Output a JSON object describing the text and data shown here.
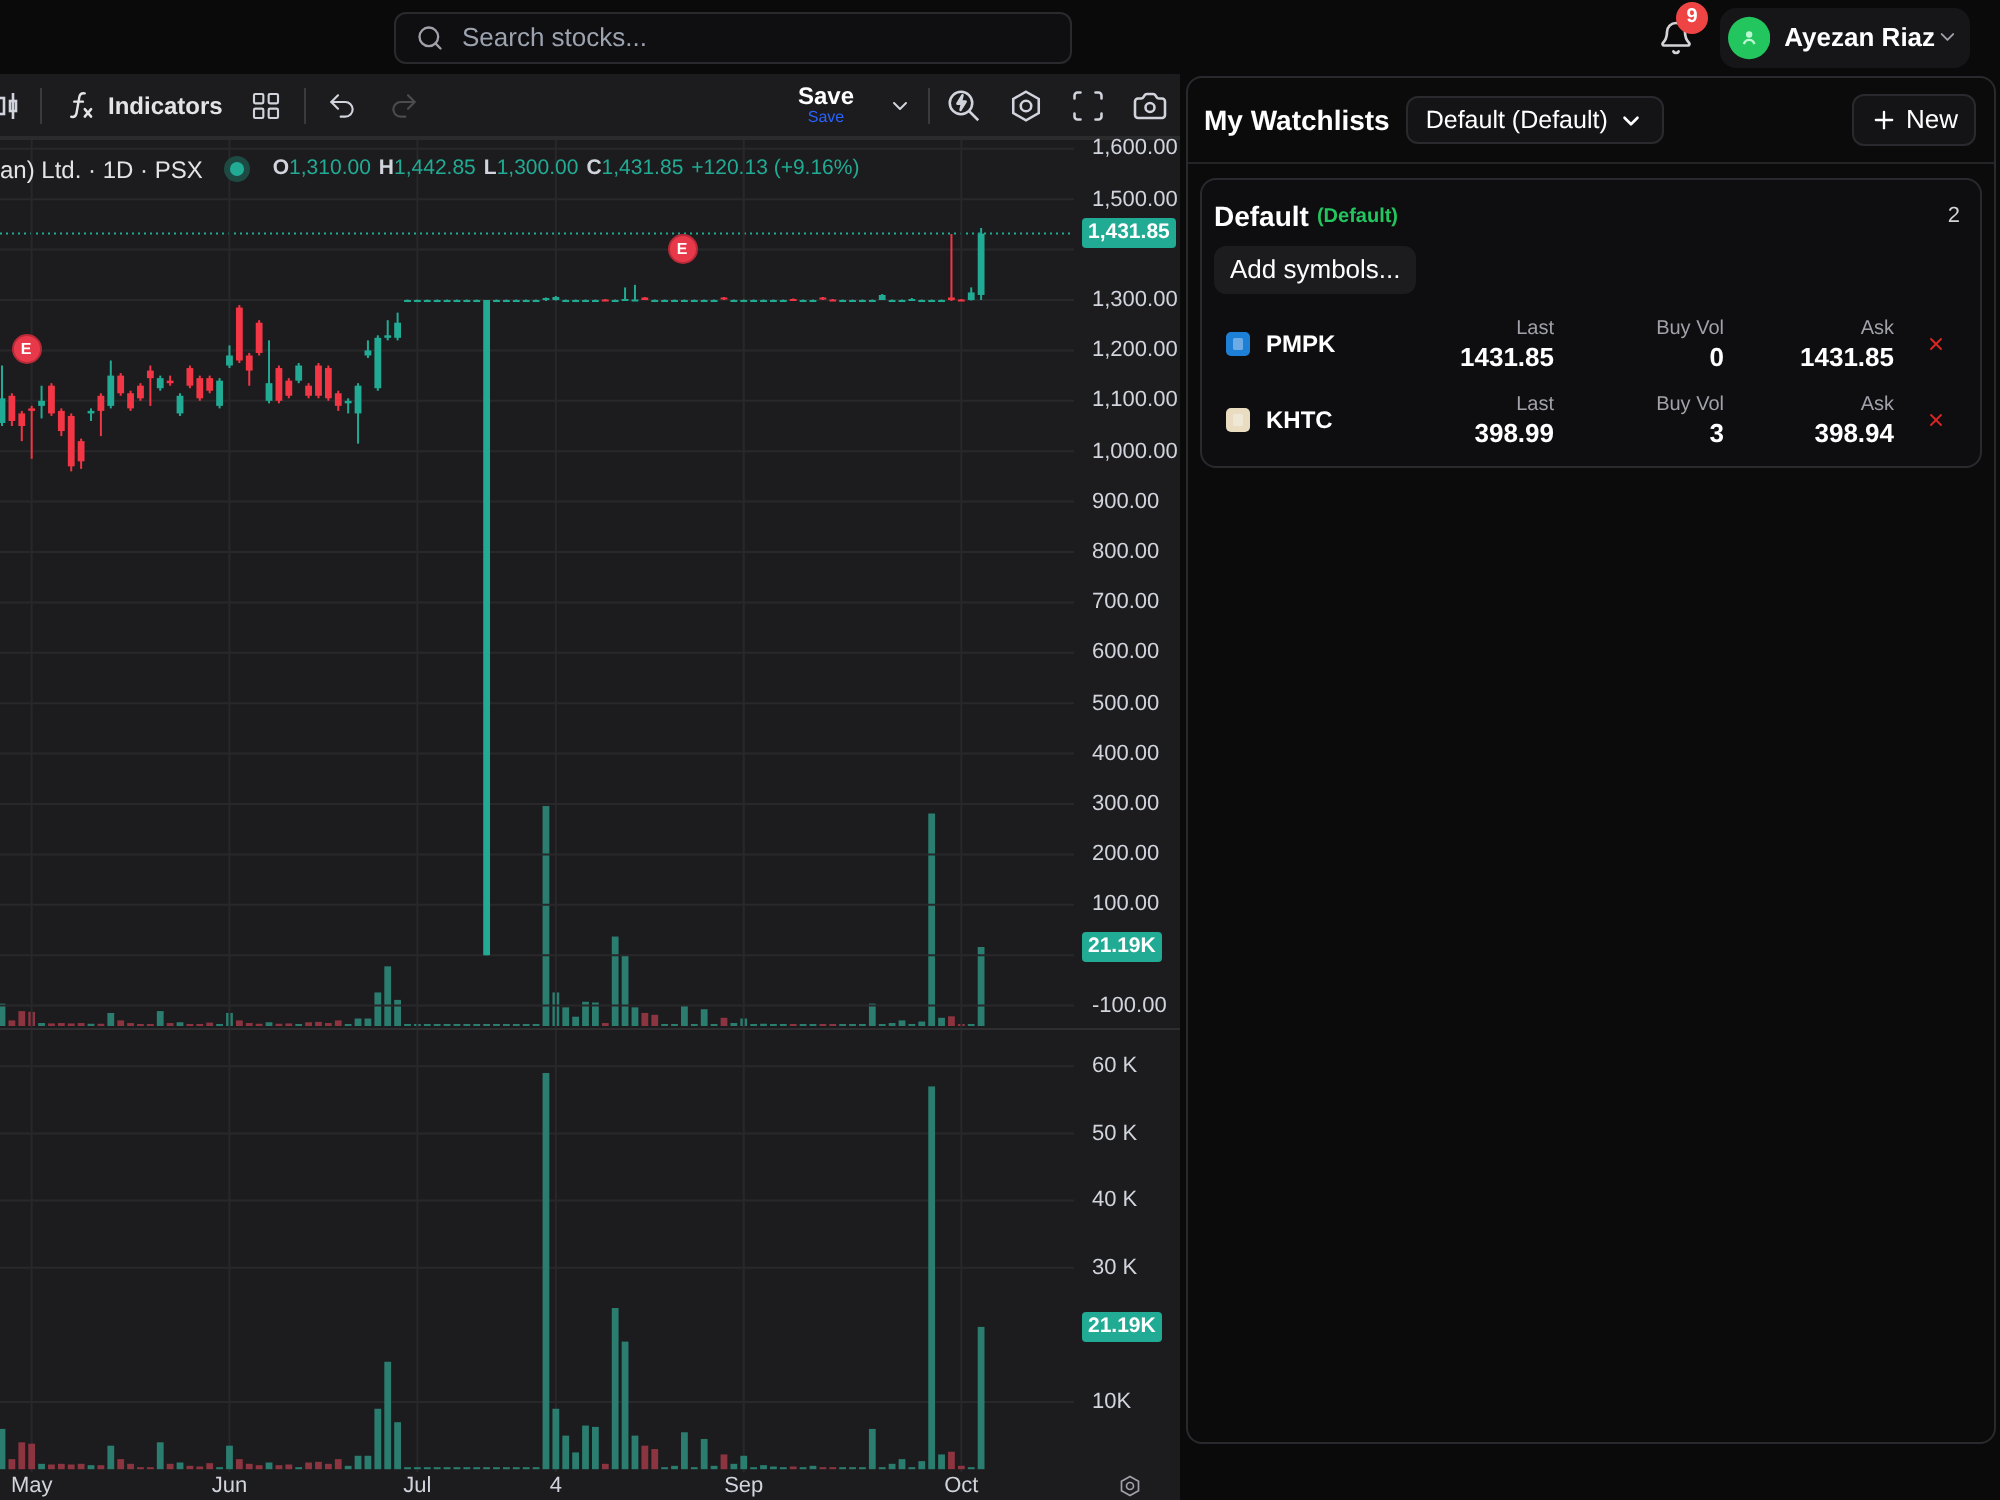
{
  "topbar": {
    "search": {
      "placeholder": "Search stocks..."
    },
    "notifications": {
      "count": "9"
    },
    "user": {
      "name": "Ayezan Riaz"
    }
  },
  "toolbar": {
    "indicators": "Indicators",
    "undo": {
      "disabled": false
    },
    "redo": {
      "disabled": true
    },
    "save": {
      "label": "Save",
      "sublabel": "Save"
    }
  },
  "legend": {
    "symbol": "an) Ltd. · 1D · PSX",
    "ohlc": [
      {
        "key": "O",
        "value": "1,310.00"
      },
      {
        "key": "H",
        "value": "1,442.85"
      },
      {
        "key": "L",
        "value": "1,300.00"
      },
      {
        "key": "C",
        "value": "1,431.85"
      }
    ],
    "change": "+120.13 (+9.16%)"
  },
  "price_pane": {
    "last_price": "1,431.85",
    "last_volume": "21.19K",
    "event_markers": [
      {
        "label": "E"
      },
      {
        "label": "E"
      }
    ],
    "chart_data": {
      "type": "candlestick",
      "grid": true,
      "categories": [
        null,
        null,
        null,
        null,
        null,
        null,
        null,
        null,
        null,
        null,
        null,
        null,
        null,
        null,
        null,
        null,
        null,
        null,
        null,
        null,
        null,
        null,
        null,
        null,
        null,
        null,
        null,
        null,
        null,
        null,
        null,
        null,
        null,
        null,
        null,
        null,
        null,
        null,
        null,
        null,
        null,
        null,
        null,
        null,
        null,
        null,
        null,
        null,
        null,
        null,
        null,
        null,
        null,
        null,
        null,
        null,
        null,
        null,
        null,
        null,
        null,
        null,
        null,
        null,
        null,
        null,
        null,
        null,
        null,
        null,
        null,
        null,
        null,
        null,
        null,
        null,
        null,
        null,
        null,
        null,
        null,
        null,
        null,
        null,
        null,
        null,
        null,
        null,
        null,
        null,
        null,
        null,
        null,
        null,
        null,
        null,
        null,
        null,
        null,
        null
      ],
      "ylim": [
        -144.4,
        1617.5
      ],
      "yticks": [
        {
          "value": 1600,
          "label": "1,600.00"
        },
        {
          "value": 1500,
          "label": "1,500.00"
        },
        {
          "value": 1300,
          "label": "1,300.00"
        },
        {
          "value": 1200,
          "label": "1,200.00"
        },
        {
          "value": 1100,
          "label": "1,100.00"
        },
        {
          "value": 1000,
          "label": "1,000.00"
        },
        {
          "value": 900,
          "label": "900.00"
        },
        {
          "value": 800,
          "label": "800.00"
        },
        {
          "value": 700,
          "label": "700.00"
        },
        {
          "value": 600,
          "label": "600.00"
        },
        {
          "value": 500,
          "label": "500.00"
        },
        {
          "value": 400,
          "label": "400.00"
        },
        {
          "value": 300,
          "label": "300.00"
        },
        {
          "value": 200,
          "label": "200.00"
        },
        {
          "value": 100,
          "label": "100.00"
        },
        {
          "value": -100,
          "label": "-100.00"
        }
      ],
      "ohlc": [
        [
          1056,
          1170,
          1050,
          1105
        ],
        [
          1110,
          1115,
          1050,
          1060
        ],
        [
          1075,
          1080,
          1020,
          1050
        ],
        [
          1085,
          1090,
          985,
          1080
        ],
        [
          1090,
          1130,
          1065,
          1100
        ],
        [
          1130,
          1135,
          1070,
          1075
        ],
        [
          1080,
          1085,
          1030,
          1040
        ],
        [
          1070,
          1075,
          960,
          970
        ],
        [
          1020,
          1025,
          965,
          980
        ],
        [
          1075,
          1085,
          1060,
          1080
        ],
        [
          1110,
          1115,
          1030,
          1080
        ],
        [
          1090,
          1180,
          1085,
          1150
        ],
        [
          1150,
          1155,
          1110,
          1115
        ],
        [
          1115,
          1120,
          1080,
          1085
        ],
        [
          1130,
          1135,
          1100,
          1105
        ],
        [
          1160,
          1170,
          1090,
          1145
        ],
        [
          1125,
          1150,
          1120,
          1145
        ],
        [
          1140,
          1150,
          1130,
          1135
        ],
        [
          1075,
          1115,
          1070,
          1110
        ],
        [
          1165,
          1170,
          1125,
          1130
        ],
        [
          1145,
          1150,
          1100,
          1105
        ],
        [
          1145,
          1150,
          1115,
          1120
        ],
        [
          1090,
          1145,
          1085,
          1140
        ],
        [
          1170,
          1210,
          1165,
          1190
        ],
        [
          1285,
          1290,
          1175,
          1180
        ],
        [
          1190,
          1195,
          1130,
          1160
        ],
        [
          1255,
          1260,
          1190,
          1195
        ],
        [
          1100,
          1220,
          1095,
          1135
        ],
        [
          1165,
          1170,
          1095,
          1100
        ],
        [
          1140,
          1145,
          1105,
          1110
        ],
        [
          1140,
          1175,
          1135,
          1170
        ],
        [
          1130,
          1135,
          1105,
          1110
        ],
        [
          1170,
          1175,
          1105,
          1110
        ],
        [
          1165,
          1170,
          1100,
          1105
        ],
        [
          1115,
          1120,
          1080,
          1090
        ],
        [
          1095,
          1105,
          1075,
          1100
        ],
        [
          1075,
          1135,
          1015,
          1130
        ],
        [
          1190,
          1220,
          1185,
          1200
        ],
        [
          1125,
          1230,
          1120,
          1225
        ],
        [
          1225,
          1260,
          1220,
          1230
        ],
        [
          1225,
          1275,
          1220,
          1255
        ],
        [
          1300,
          1301,
          1299,
          1300
        ],
        [
          1300,
          1301,
          1299,
          1300
        ],
        [
          1300,
          1301,
          1299,
          1300
        ],
        [
          1300,
          1301,
          1299,
          1300
        ],
        [
          1300,
          1301,
          1299,
          1300
        ],
        [
          1300,
          1301,
          1299,
          1300
        ],
        [
          1300,
          1301,
          1299,
          1300
        ],
        [
          1300,
          1301,
          1299,
          1300
        ],
        [
          0,
          1300,
          0,
          1300
        ],
        [
          1300,
          1301,
          1299,
          1300
        ],
        [
          1300,
          1301,
          1299,
          1300
        ],
        [
          1300,
          1301,
          1299,
          1300
        ],
        [
          1300,
          1301,
          1299,
          1300
        ],
        [
          1300,
          1301,
          1299,
          1300
        ],
        [
          1300,
          1305,
          1298,
          1304
        ],
        [
          1300,
          1308,
          1299,
          1306
        ],
        [
          1300,
          1301,
          1299,
          1300
        ],
        [
          1300,
          1301,
          1299,
          1300
        ],
        [
          1300,
          1301,
          1299,
          1300
        ],
        [
          1300,
          1301,
          1299,
          1300
        ],
        [
          1301,
          1302,
          1300,
          1300
        ],
        [
          1300,
          1301,
          1299,
          1300
        ],
        [
          1300,
          1325,
          1300,
          1302
        ],
        [
          1300,
          1330,
          1300,
          1301
        ],
        [
          1305,
          1306,
          1300,
          1300
        ],
        [
          1300,
          1301,
          1299,
          1300
        ],
        [
          1300,
          1301,
          1299,
          1300
        ],
        [
          1300,
          1301,
          1299,
          1300
        ],
        [
          1300,
          1301,
          1299,
          1300
        ],
        [
          1300,
          1301,
          1299,
          1300
        ],
        [
          1300,
          1301,
          1299,
          1300
        ],
        [
          1300,
          1301,
          1299,
          1300
        ],
        [
          1305,
          1306,
          1300,
          1301
        ],
        [
          1300,
          1301,
          1299,
          1300
        ],
        [
          1300,
          1301,
          1299,
          1300
        ],
        [
          1300,
          1301,
          1299,
          1300
        ],
        [
          1300,
          1301,
          1299,
          1300
        ],
        [
          1300,
          1301,
          1299,
          1300
        ],
        [
          1300,
          1301,
          1299,
          1300
        ],
        [
          1302,
          1303,
          1300,
          1300
        ],
        [
          1300,
          1301,
          1299,
          1300
        ],
        [
          1300,
          1301,
          1299,
          1300
        ],
        [
          1305,
          1306,
          1300,
          1301
        ],
        [
          1301,
          1302,
          1300,
          1300
        ],
        [
          1300,
          1301,
          1299,
          1300
        ],
        [
          1300,
          1301,
          1299,
          1300
        ],
        [
          1300,
          1301,
          1299,
          1300
        ],
        [
          1300,
          1301,
          1299,
          1300
        ],
        [
          1300,
          1312,
          1300,
          1310
        ],
        [
          1300,
          1301,
          1299,
          1300
        ],
        [
          1300,
          1301,
          1299,
          1300
        ],
        [
          1300,
          1304,
          1299,
          1302
        ],
        [
          1300,
          1301,
          1299,
          1300
        ],
        [
          1300,
          1301,
          1299,
          1300
        ],
        [
          1300,
          1301,
          1299,
          1300
        ],
        [
          1305,
          1431,
          1298,
          1300
        ],
        [
          1301,
          1302,
          1300,
          1300
        ],
        [
          1300,
          1325,
          1299,
          1315
        ],
        [
          1310,
          1442.85,
          1300,
          1431.85
        ]
      ]
    }
  },
  "volume_pane": {
    "last_volume": "21.19K",
    "chart_data": {
      "type": "bar",
      "grid": true,
      "categories": [
        null,
        null,
        null,
        "May",
        null,
        null,
        null,
        null,
        null,
        null,
        null,
        null,
        null,
        null,
        null,
        null,
        null,
        null,
        null,
        null,
        null,
        null,
        null,
        "Jun",
        null,
        null,
        null,
        null,
        null,
        null,
        null,
        null,
        null,
        null,
        null,
        null,
        null,
        null,
        null,
        null,
        null,
        null,
        "Jul",
        null,
        null,
        null,
        null,
        null,
        null,
        null,
        null,
        null,
        null,
        null,
        null,
        null,
        "4",
        null,
        null,
        null,
        null,
        null,
        null,
        null,
        null,
        null,
        null,
        null,
        null,
        null,
        null,
        null,
        null,
        null,
        null,
        "Sep",
        null,
        null,
        null,
        null,
        null,
        null,
        null,
        null,
        null,
        null,
        null,
        null,
        null,
        null,
        null,
        null,
        null,
        null,
        null,
        null,
        null,
        "Oct",
        null,
        null
      ],
      "ylim": [
        0,
        65400
      ],
      "yticks": [
        {
          "value": 10000,
          "label": "10K"
        },
        {
          "value": 30000,
          "label": "30 K"
        },
        {
          "value": 40000,
          "label": "40 K"
        },
        {
          "value": 50000,
          "label": "50 K"
        },
        {
          "value": 60000,
          "label": "60 K"
        }
      ],
      "series": [
        {
          "color": "#2a7d6f",
          "values": [
            6000,
            null,
            null,
            null,
            800,
            null,
            null,
            null,
            null,
            600,
            null,
            3500,
            null,
            null,
            null,
            null,
            4000,
            null,
            1000,
            null,
            null,
            null,
            300,
            3500,
            null,
            null,
            null,
            1000,
            null,
            null,
            200,
            null,
            null,
            null,
            null,
            500,
            2000,
            2000,
            9000,
            16000,
            7000,
            200,
            200,
            200,
            200,
            200,
            200,
            200,
            200,
            200,
            200,
            200,
            200,
            200,
            200,
            59000,
            9000,
            5000,
            2500,
            6500,
            6300,
            null,
            24000,
            19000,
            5000,
            null,
            null,
            300,
            500,
            5500,
            300,
            4500,
            500,
            null,
            800,
            2000,
            300,
            600,
            400,
            300,
            null,
            300,
            500,
            null,
            null,
            300,
            300,
            300,
            6000,
            300,
            800,
            1500,
            300,
            1200,
            57000,
            2200,
            null,
            null,
            200,
            21190
          ]
        },
        {
          "color": "#8c3440",
          "values": [
            null,
            1500,
            4000,
            3800,
            null,
            700,
            800,
            700,
            800,
            null,
            600,
            null,
            1500,
            800,
            300,
            300,
            null,
            800,
            null,
            500,
            400,
            900,
            null,
            null,
            1500,
            800,
            600,
            null,
            600,
            700,
            null,
            1000,
            1100,
            800,
            1500,
            null,
            null,
            null,
            null,
            null,
            null,
            null,
            null,
            null,
            null,
            null,
            null,
            null,
            null,
            null,
            null,
            null,
            null,
            null,
            null,
            null,
            null,
            null,
            null,
            null,
            null,
            800,
            null,
            null,
            null,
            3500,
            3000,
            null,
            null,
            null,
            null,
            null,
            null,
            2200,
            null,
            null,
            null,
            null,
            null,
            null,
            400,
            null,
            null,
            300,
            300,
            null,
            null,
            null,
            null,
            null,
            null,
            null,
            null,
            null,
            null,
            null,
            2600,
            500,
            null,
            null
          ]
        }
      ]
    }
  },
  "watchlists": {
    "title": "My Watchlists",
    "selector": "Default (Default)",
    "new_button": "New",
    "lists": [
      {
        "name": "Default",
        "tag": "(Default)",
        "count": "2",
        "add_button": "Add symbols...",
        "symbols": [
          {
            "symbol": "PMPK",
            "color": "#1e7fd6",
            "fields": [
              {
                "label": "Last",
                "value": "1431.85"
              },
              {
                "label": "Buy Vol",
                "value": "0"
              },
              {
                "label": "Ask",
                "value": "1431.85"
              }
            ]
          },
          {
            "symbol": "KHTC",
            "color": "#e9dcc0",
            "fields": [
              {
                "label": "Last",
                "value": "398.99"
              },
              {
                "label": "Buy Vol",
                "value": "3"
              },
              {
                "label": "Ask",
                "value": "398.94"
              }
            ]
          }
        ]
      }
    ]
  }
}
